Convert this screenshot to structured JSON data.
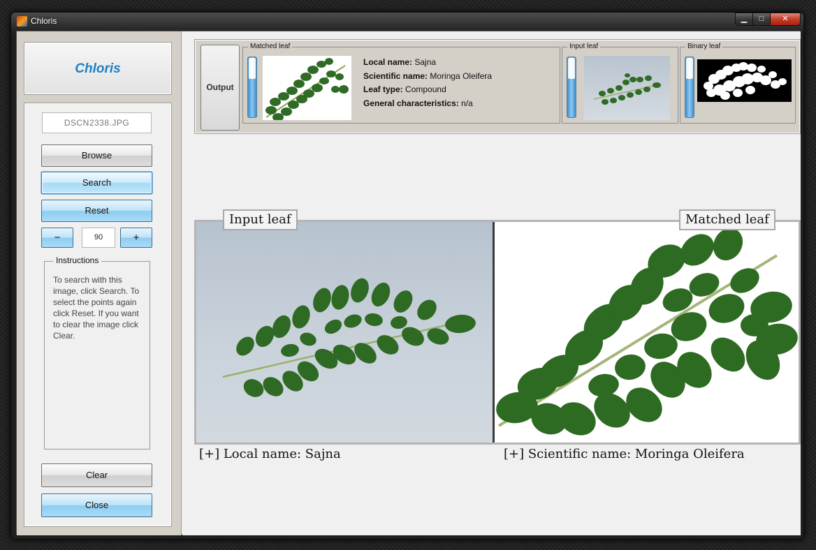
{
  "window": {
    "title": "Chloris",
    "min_glyph": "▁",
    "max_glyph": "□",
    "close_glyph": "✕"
  },
  "sidebar": {
    "logo": "Chloris",
    "filename": "DSCN2338.JPG",
    "browse": "Browse",
    "search": "Search",
    "reset": "Reset",
    "minus": "−",
    "zoom": "90",
    "plus": "+",
    "instructions_title": "Instructions",
    "instructions_text": "To search with this image, click Search. To select the points again click Reset. If you want to clear the image click Clear.",
    "clear": "Clear",
    "close": "Close"
  },
  "output": {
    "button": "Output",
    "matched_leaf_label": "Matched leaf",
    "input_leaf_label": "Input leaf",
    "binary_leaf_label": "Binary leaf",
    "local_name_key": "Local name:",
    "local_name": "Sajna",
    "scientific_name_key": "Scientific name:",
    "scientific_name": "Moringa Oleifera",
    "leaf_type_key": "Leaf type:",
    "leaf_type": "Compound",
    "general_key": "General characteristics:",
    "general": "n/a"
  },
  "comparison": {
    "input_tag": "Input leaf",
    "matched_tag": "Matched leaf",
    "caption_left": "[+] Local name: Sajna",
    "caption_right": "[+] Scientific name: Moringa Oleifera"
  },
  "colors": {
    "accent": "#1f7fc3",
    "leaf": "#2f6b25",
    "button_blue": "#a9dbf6"
  }
}
